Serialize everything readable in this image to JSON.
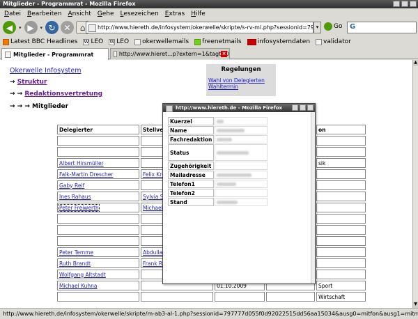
{
  "window": {
    "title": "Mitglieder - Programmrat - Mozilla Firefox"
  },
  "menu": [
    "Datei",
    "Bearbeiten",
    "Ansicht",
    "Gehe",
    "Lesezeichen",
    "Extras",
    "Hilfe"
  ],
  "nav": {
    "url": "http://www.hiereth.de/infosystem/okerwelle/skripte/s-rv-mi.php?sessionid=797777c",
    "go_label": "Go"
  },
  "bookmarks": [
    {
      "label": "Latest BBC Headlines",
      "icon": "rss-icon"
    },
    {
      "label": "LEO",
      "icon": "wiki-icon"
    },
    {
      "label": "LEO",
      "icon": "leo-icon"
    },
    {
      "label": "okerwellemails",
      "icon": "page-icon"
    },
    {
      "label": "freenetmails",
      "icon": "freenet-icon"
    },
    {
      "label": "infosystemdaten",
      "icon": "red-badge-icon"
    },
    {
      "label": "validator",
      "icon": "page-icon"
    }
  ],
  "tabs": [
    {
      "label": "Mitglieder - Programmrat",
      "active": true
    },
    {
      "label": "http://www.hieret...p?extern=1&tagt=0",
      "active": false
    }
  ],
  "page": {
    "site_title": "Okerwelle Infosystem",
    "crumbs": [
      {
        "arrows": "→",
        "label": "Struktur"
      },
      {
        "arrows": "→ →",
        "label": "Redaktionsvertretung"
      },
      {
        "arrows": "→ → →",
        "label": "Mitglieder"
      }
    ],
    "regelungen": {
      "title": "Regelungen",
      "links": [
        "Wahl von Delegierten",
        "Wahltermin"
      ]
    },
    "table": {
      "headers": [
        "Delegierter",
        "Stellvert",
        "",
        "",
        "on"
      ],
      "rows": [
        [
          "",
          "",
          "",
          "",
          ""
        ],
        [
          "",
          "",
          "",
          "",
          ""
        ],
        [
          "Albert Hirsmüller",
          "",
          "",
          "",
          "sik"
        ],
        [
          "Falk-Martin Drescher",
          "Felix Kro",
          "",
          "",
          ""
        ],
        [
          "Gaby Reif",
          "",
          "",
          "",
          ""
        ],
        [
          "Ines Rahaus",
          "Sylvia Sc",
          "",
          "",
          ""
        ],
        [
          "Peter Freiwerth",
          "Michael F",
          "",
          "",
          ""
        ],
        [
          "",
          "",
          "",
          "",
          ""
        ],
        [
          "",
          "",
          "",
          "",
          ""
        ],
        [
          "",
          "",
          "",
          "",
          ""
        ],
        [
          "Peter Temme",
          "Abdullah",
          "",
          "",
          ""
        ],
        [
          "Ruth Brandt",
          "Frank R.",
          "",
          "",
          ""
        ],
        [
          "Wolfgang Altstadt",
          "",
          "",
          "",
          ""
        ],
        [
          "Michael Kuhna",
          "",
          "01.10.2009",
          "",
          "Sport"
        ],
        [
          "",
          "",
          "",
          "",
          "Wirtschaft"
        ]
      ]
    }
  },
  "popup": {
    "title": "http://www.hiereth.de - Mozilla Firefox",
    "fields": [
      "Kuerzel",
      "Name",
      "Fachredaktion",
      "Status",
      "Zugehörigkeit",
      "Mailadresse",
      "Telefon1",
      "Telefon2",
      "Stand"
    ]
  },
  "statusbar": {
    "text": "http://www.hiereth.de/infosystem/okerwelle/skripte/m-ab3-al-1.php?sessionid=797777d055f0d92022515dd56aa15034&ausg0=mitfon&ausg1=mitmail#pfr"
  }
}
